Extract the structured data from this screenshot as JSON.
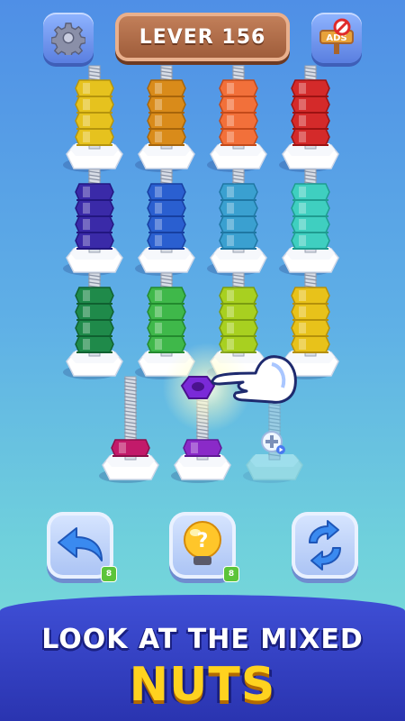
{
  "header": {
    "level_label": "LEVER 156",
    "settings_icon": "gear-icon",
    "no_ads_icon": "no-ads-sign-icon",
    "no_ads_text": "ADS"
  },
  "board": {
    "bolts": [
      {
        "color": "#e6c21e",
        "dark": "#b5940c",
        "nuts": 4
      },
      {
        "color": "#d98b1a",
        "dark": "#a7650a",
        "nuts": 4
      },
      {
        "color": "#f2703a",
        "dark": "#c34a1a",
        "nuts": 4
      },
      {
        "color": "#d42a2a",
        "dark": "#9c1212",
        "nuts": 4
      },
      {
        "color": "#3a2aa8",
        "dark": "#221680",
        "nuts": 4
      },
      {
        "color": "#2a5fd0",
        "dark": "#173fa0",
        "nuts": 4
      },
      {
        "color": "#3aa0d0",
        "dark": "#1f77a3",
        "nuts": 4
      },
      {
        "color": "#3fcfc0",
        "dark": "#1f9c90",
        "nuts": 4
      },
      {
        "color": "#1f8a4a",
        "dark": "#0f6030",
        "nuts": 4
      },
      {
        "color": "#3fb84a",
        "dark": "#23892e",
        "nuts": 4
      },
      {
        "color": "#a8d020",
        "dark": "#7a9c10",
        "nuts": 4
      },
      {
        "color": "#e8c21a",
        "dark": "#b5900a",
        "nuts": 4
      },
      {
        "color": "#c21a6a",
        "dark": "#8a0f4a",
        "nuts": 1
      },
      {
        "color": "#8a2ac8",
        "dark": "#5f1895",
        "nuts": 1
      },
      {
        "color": "#9fe0d8",
        "dark": "#7cc0b8",
        "nuts": 0,
        "ghost": true
      }
    ],
    "lifted_nut_color": "#7a2ad8",
    "add_bolt_icon": "plus-icon"
  },
  "actions": {
    "undo": {
      "icon": "undo-arrow-icon",
      "count": "8"
    },
    "hint": {
      "icon": "lightbulb-question-icon",
      "count": "8",
      "glyph": "?"
    },
    "shuffle": {
      "icon": "refresh-icon"
    }
  },
  "caption": {
    "line1": "LOOK AT THE MIXED",
    "line2": "NUTS"
  },
  "tutorial": {
    "hand_icon": "pointing-hand-icon"
  }
}
